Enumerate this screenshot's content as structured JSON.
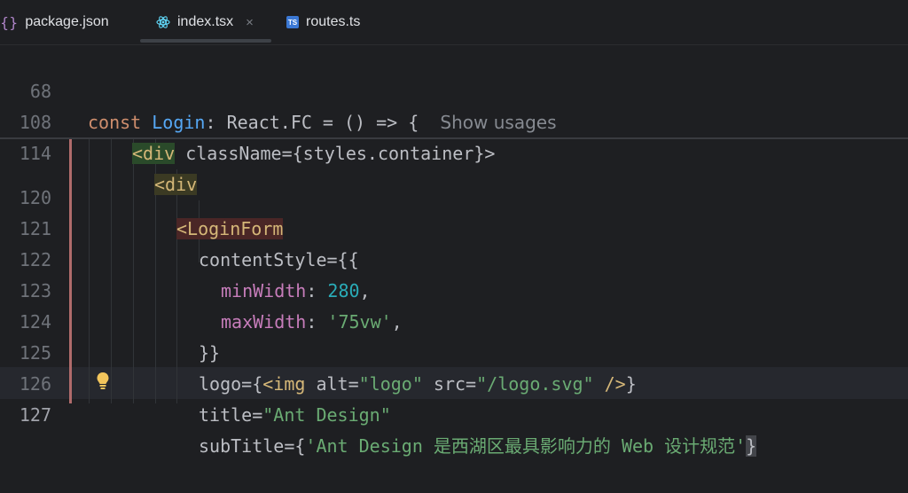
{
  "tabs": [
    {
      "label": "package.json",
      "icon": "json-braces-icon",
      "active": false
    },
    {
      "label": "index.tsx",
      "icon": "react-icon",
      "active": true,
      "close": "×"
    },
    {
      "label": "routes.ts",
      "icon": "typescript-icon",
      "badge": "TS",
      "active": false
    }
  ],
  "sticky": [
    {
      "num": "68",
      "parts": [
        "const",
        "Login",
        ": React.FC = () => {",
        "Show usages"
      ]
    },
    {
      "num": "108",
      "parts": [
        "<div",
        " className={styles.container}>"
      ]
    },
    {
      "num": "114",
      "parts": [
        "<div"
      ]
    }
  ],
  "lines": [
    {
      "num": "120",
      "parts": [
        "<LoginForm"
      ]
    },
    {
      "num": "121",
      "parts": [
        "contentStyle={{"
      ]
    },
    {
      "num": "122",
      "parts": [
        "minWidth",
        ": ",
        "280",
        ","
      ]
    },
    {
      "num": "123",
      "parts": [
        "maxWidth",
        ": ",
        "'75vw'",
        ","
      ]
    },
    {
      "num": "124",
      "parts": [
        "}}"
      ]
    },
    {
      "num": "125",
      "parts": [
        "logo={",
        "<img",
        " alt=",
        "\"logo\"",
        " src=",
        "\"/logo.svg\"",
        " />",
        "}"
      ]
    },
    {
      "num": "126",
      "parts": [
        "title=",
        "\"Ant Design\""
      ]
    },
    {
      "num": "127",
      "parts": [
        "subTitle={",
        "'Ant Design 是西湖区最具影响力的 Web 设计规范'",
        "}"
      ]
    }
  ],
  "colors": {
    "accent": "#3b78d4",
    "background": "#1e1f22",
    "vcs_modified": "#b06b6b"
  }
}
